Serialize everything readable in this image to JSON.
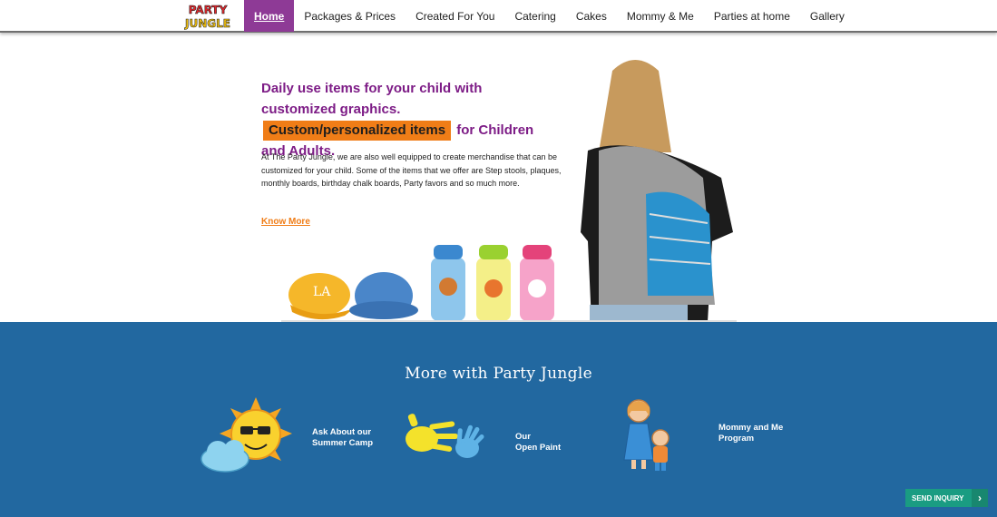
{
  "brand": {
    "logo_text": "PARTY JUNGLE"
  },
  "nav": {
    "items": [
      {
        "label": "Home",
        "active": true
      },
      {
        "label": "Packages & Prices"
      },
      {
        "label": "Created For You"
      },
      {
        "label": "Catering"
      },
      {
        "label": "Cakes"
      },
      {
        "label": "Mommy & Me"
      },
      {
        "label": "Parties at home"
      },
      {
        "label": "Gallery"
      }
    ]
  },
  "hero": {
    "headline_part1": "Daily use items for your child with customized graphics.",
    "headline_highlight": "Custom/personalized items",
    "headline_part2": "for Children and Adults.",
    "body": "At The Party Jungle, we are also well equipped to create merchandise that can be customized for your child. Some of the items that we offer are Step stools, plaques, monthly boards, birthday chalk boards, Party favors and so much more.",
    "cta": "Know More"
  },
  "more": {
    "title": "More with Party Jungle",
    "features": [
      {
        "label": "Ask About our\nSummer Camp",
        "icon": "sun-cloud-icon"
      },
      {
        "label": "Our\nOpen Paint",
        "icon": "handprint-icon"
      },
      {
        "label": "Mommy and Me\nProgram",
        "icon": "mother-child-icon"
      }
    ]
  },
  "send_inquiry": {
    "label": "SEND INQUIRY"
  },
  "colors": {
    "nav_active": "#8e3a96",
    "headline": "#7d1c86",
    "accent": "#f07d17",
    "section_bg": "#2268a0",
    "inquiry": "#1a9c82"
  }
}
